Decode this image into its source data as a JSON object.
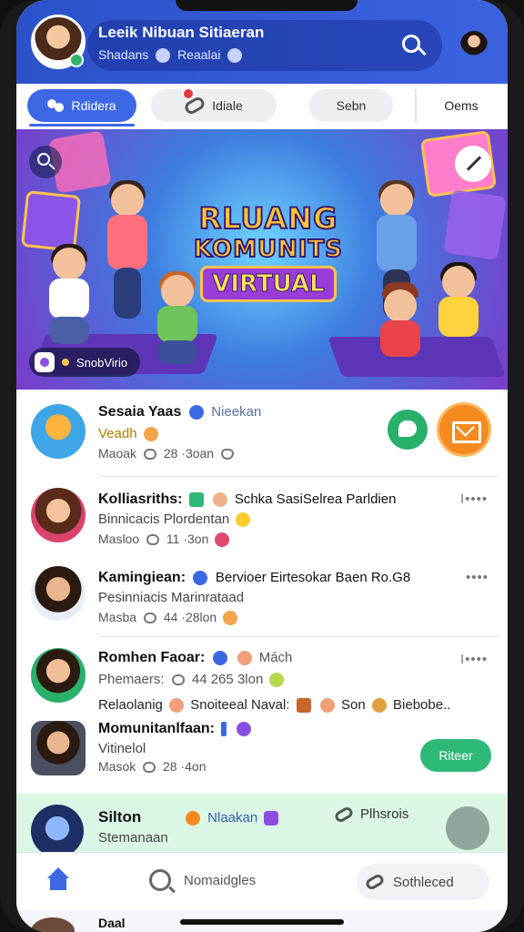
{
  "header": {
    "title": "Leeik Nibuan Sitiaeran",
    "sub_left": "Shadans",
    "sub_right": "Reaalai"
  },
  "tabs": [
    {
      "label": "Rdidera"
    },
    {
      "label": "Idiale"
    },
    {
      "label": "Sebn"
    },
    {
      "label": "Oems"
    }
  ],
  "banner": {
    "title_line1": "RLUANG",
    "title_line2": "KOMUNITS",
    "title_line3": "VIRTUAL",
    "chip_label": "SnobVirio"
  },
  "feed": [
    {
      "name": "Sesaia Yaas",
      "tag": "Nieekan",
      "line2": "Veadh",
      "meta_left": "Maoak",
      "meta_num": "28",
      "meta_right": "·3oan"
    },
    {
      "name": "Kolliasriths:",
      "tag": "Schka SasiSelrea Parldien",
      "line2": "Binnicacis Plordentan",
      "meta_left": "Masloo",
      "meta_num": "11",
      "meta_right": "·3on",
      "more": "I••••"
    },
    {
      "name": "Kamingiean:",
      "tag": "Bervioer Eirtesokar Baen Ro.G8",
      "line2": "Pesinniacis Marinrataad",
      "meta_left": "Masba",
      "meta_num": "44",
      "meta_right": "·28lon",
      "more": "••••"
    },
    {
      "name": "Romhen Faoar:",
      "tag": "Mách",
      "line2": "Phemaers:",
      "meta_num": "44",
      "meta_right": "265 3lon",
      "more": "I••••"
    },
    {
      "name": "Relaolanig",
      "tag": "Snoiteeal Naval:",
      "extra": "Son",
      "extra2": "Biebobe..",
      "line2": ""
    },
    {
      "name": "Momunitanlfaan:",
      "line2": "Vitinelol",
      "meta_left": "Masok",
      "meta_num": "28",
      "meta_right": "·4on",
      "action": "Riteer"
    }
  ],
  "highlight": {
    "name": "Silton",
    "tag": "Nlaakan",
    "sub": "Stemanaan",
    "link": "Plhsrois"
  },
  "bottom_nav": {
    "search_label": "Nomaidgles",
    "pill_label": "Sothleced"
  },
  "peek": {
    "name": "Daal"
  },
  "colors": {
    "primary": "#3c68e6",
    "header_bg": "#2c52c9",
    "green": "#2fb978",
    "orange": "#f58a1f",
    "highlight_bg": "#dcf6e6"
  }
}
